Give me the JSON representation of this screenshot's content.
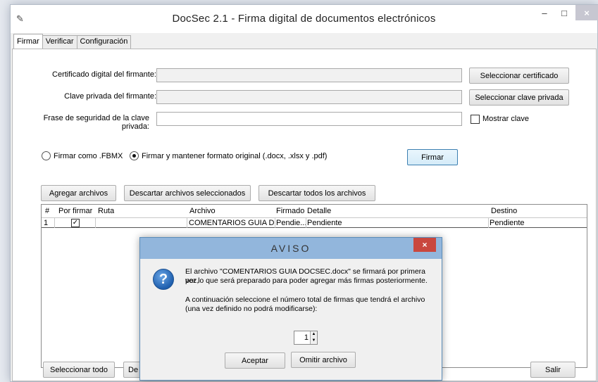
{
  "window": {
    "title": "DocSec 2.1 - Firma digital de documentos electrónicos",
    "controls": {
      "minimize": "–",
      "maximize": "□",
      "close": "×"
    }
  },
  "tabs": [
    {
      "label": "Firmar",
      "active": true
    },
    {
      "label": "Verificar",
      "active": false
    },
    {
      "label": "Configuración",
      "active": false
    }
  ],
  "form": {
    "cert_label": "Certificado digital del firmante:",
    "key_label": "Clave privada del firmante:",
    "pass_label": "Frase de seguridad de la clave privada:",
    "cert_value": "",
    "key_value": "",
    "pass_value": "",
    "select_cert_button": "Seleccionar certificado",
    "select_key_button": "Seleccionar clave privada",
    "show_key_label": "Mostrar clave",
    "show_key_checked": false
  },
  "options": {
    "fbmx_label": "Firmar como .FBMX",
    "original_label": "Firmar y mantener formato original (.docx, .xlsx y .pdf)",
    "selected": "original",
    "sign_button": "Firmar"
  },
  "file_actions": {
    "add": "Agregar archivos",
    "discard_selected": "Descartar archivos seleccionados",
    "discard_all": "Descartar todos los archivos"
  },
  "table": {
    "columns": [
      "#",
      "Por firmar",
      "Ruta",
      "Archivo",
      "Firmado",
      "Detalle",
      "Destino"
    ],
    "rows": [
      {
        "num": "1",
        "checked": true,
        "ruta": "",
        "archivo": "COMENTARIOS GUIA D...",
        "firmado": "Pendie...",
        "detalle": "Pendiente",
        "destino": "Pendiente"
      }
    ]
  },
  "footer": {
    "select_all": "Seleccionar todo",
    "partial": "De",
    "exit": "Salir"
  },
  "dialog": {
    "title": "AVISO",
    "close": "×",
    "line1": "El archivo \"COMENTARIOS GUIA DOCSEC.docx\" se firmará por primera vez,",
    "line2": "por lo que será preparado para poder agregar más firmas posteriormente.",
    "line3": "A continuación seleccione el número total de firmas que tendrá el archivo",
    "line4": "(una vez definido no podrá modificarse):",
    "spin_value": "1",
    "accept": "Aceptar",
    "skip": "Omitir archivo",
    "icon": "question-icon"
  },
  "colors": {
    "dialog_title_bg": "#92b6dc",
    "close_red": "#c9473e",
    "primary_border": "#3c7fb1"
  }
}
